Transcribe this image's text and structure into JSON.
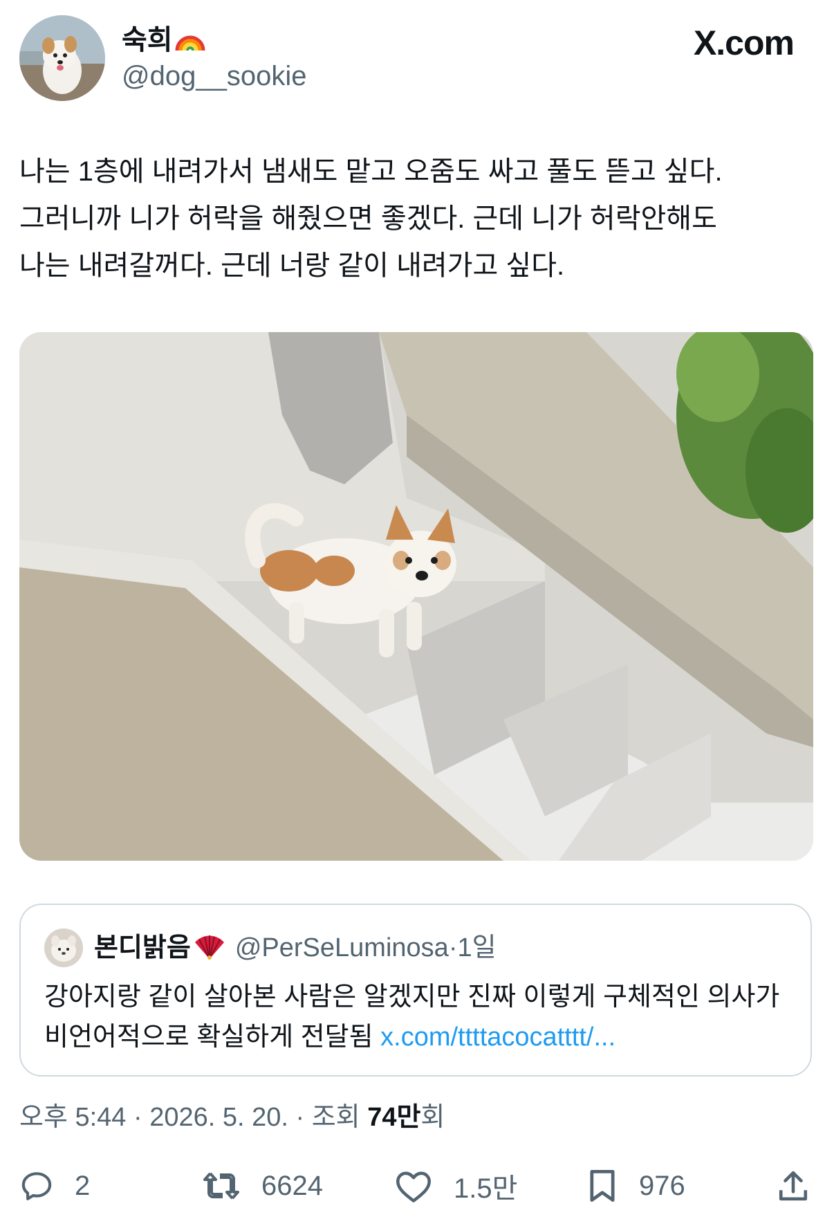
{
  "author": {
    "name": "숙희",
    "name_emoji_icon": "rainbow-icon",
    "handle": "@dog__sookie"
  },
  "brand": {
    "label": "X.com"
  },
  "tweet": {
    "text": "나는 1층에 내려가서 냄새도 맡고 오줌도 싸고 풀도 뜯고 싶다.\n그러니까 니가 허락을 해줬으면 좋겠다. 근데 니가 허락안해도\n나는 내려갈꺼다. 근데 너랑 같이 내려가고 싶다."
  },
  "photo": {
    "icon": "dog-on-stairs-photo"
  },
  "quote": {
    "name": "본디밝음",
    "name_emoji_icon": "fan-icon",
    "handle": "@PerSeLuminosa",
    "dot": "·",
    "time": "1일",
    "text": "강아지랑 같이 살아본 사람은 알겠지만 진짜 이렇게 구체적인 의사가 비언어적으로 확실하게 전달됨 ",
    "link": "x.com/ttttacocatttt/..."
  },
  "meta": {
    "time_date": "오후 5:44 · 2026. 5. 20. · 조회 ",
    "views_num": "74만",
    "views_suffix": "회"
  },
  "actions": {
    "reply_count": "2",
    "repost_count": "6624",
    "like_count": "1.5만",
    "bookmark_count": "976"
  },
  "colors": {
    "text": "#0f1419",
    "secondary": "#536471",
    "link": "#1d9bf0",
    "border": "#cfd9de"
  }
}
